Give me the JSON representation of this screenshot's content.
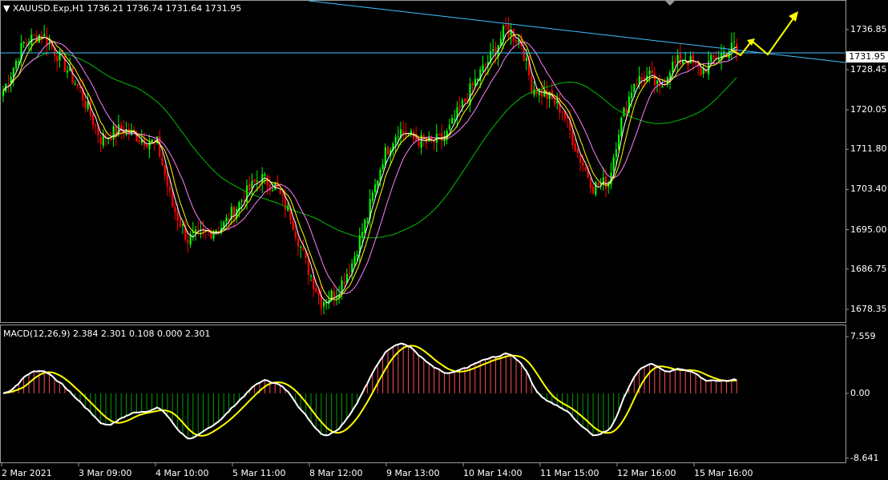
{
  "header": {
    "symbol_line": "XAUUSD.Exp,H1  1736.21 1736.74 1731.64 1731.95",
    "macd_line": "MACD(12,26,9) 2.384 2.301 0.108 0.000 2.301",
    "current_price": "1731.95"
  },
  "colors": {
    "background": "#000000",
    "bull": "#00ff00",
    "bear": "#ff0000",
    "ma_fast": "#ffffff",
    "ma_yellow": "#ffff00",
    "ma_violet": "#ff80ff",
    "ma_slow": "#00c000",
    "trendline": "#40c0ff",
    "arrow": "#ffff00",
    "macd_line": "#ffffff",
    "signal_line": "#ffff00",
    "hist_pos": "#ff5050",
    "hist_neg": "#00a000"
  },
  "chart_data": [
    {
      "type": "candlestick",
      "title": "XAUUSD.Exp,H1",
      "y_ticks": [
        "1736.85",
        "1728.45",
        "1720.05",
        "1711.80",
        "1703.40",
        "1695.00",
        "1686.75",
        "1678.35"
      ],
      "x_ticks": [
        "2 Mar 2021",
        "3 Mar 09:00",
        "4 Mar 10:00",
        "5 Mar 11:00",
        "8 Mar 12:00",
        "9 Mar 13:00",
        "10 Mar 14:00",
        "11 Mar 15:00",
        "12 Mar 16:00",
        "15 Mar 16:00"
      ],
      "ylim": [
        1676,
        1742
      ],
      "last_price": 1731.95,
      "keypoints": [
        [
          0,
          1724
        ],
        [
          8,
          1734
        ],
        [
          15,
          1736
        ],
        [
          22,
          1731
        ],
        [
          30,
          1724
        ],
        [
          38,
          1714
        ],
        [
          46,
          1716
        ],
        [
          54,
          1714
        ],
        [
          60,
          1713
        ],
        [
          66,
          1700
        ],
        [
          72,
          1693
        ],
        [
          78,
          1694
        ],
        [
          86,
          1696
        ],
        [
          94,
          1702
        ],
        [
          100,
          1706
        ],
        [
          106,
          1704
        ],
        [
          112,
          1698
        ],
        [
          118,
          1688
        ],
        [
          124,
          1680
        ],
        [
          130,
          1682
        ],
        [
          136,
          1688
        ],
        [
          142,
          1698
        ],
        [
          148,
          1710
        ],
        [
          154,
          1716
        ],
        [
          160,
          1714
        ],
        [
          166,
          1713
        ],
        [
          172,
          1714
        ],
        [
          178,
          1720
        ],
        [
          184,
          1726
        ],
        [
          190,
          1731
        ],
        [
          196,
          1737
        ],
        [
          202,
          1734
        ],
        [
          206,
          1725
        ],
        [
          212,
          1723
        ],
        [
          218,
          1720
        ],
        [
          224,
          1711
        ],
        [
          230,
          1704
        ],
        [
          236,
          1705
        ],
        [
          240,
          1716
        ],
        [
          246,
          1726
        ],
        [
          252,
          1727
        ],
        [
          256,
          1724
        ],
        [
          260,
          1729
        ],
        [
          266,
          1731
        ],
        [
          272,
          1728
        ],
        [
          278,
          1731
        ],
        [
          284,
          1733
        ],
        [
          286,
          1734
        ]
      ],
      "overlays": [
        "ma_fast",
        "ma_yellow",
        "ma_violet",
        "ma_slow",
        "trendline",
        "horizontal_price_line",
        "forecast_arrows"
      ]
    },
    {
      "type": "macd",
      "title": "MACD(12,26,9)",
      "values": {
        "macd": 2.384,
        "signal": 2.301,
        "hist_a": 0.108,
        "hist_b": 0.0,
        "hist_c": 2.301
      },
      "y_ticks": [
        "7.559",
        "0.00",
        "-8.641"
      ],
      "ylim": [
        -9,
        8
      ]
    }
  ]
}
